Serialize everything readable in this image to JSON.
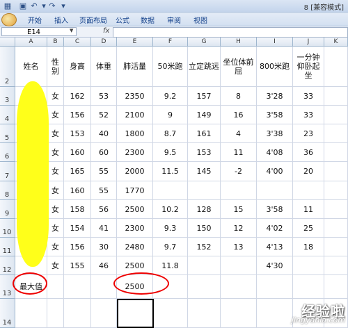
{
  "window": {
    "title": "8 [兼容模式]"
  },
  "ribbon": {
    "tabs": [
      "开始",
      "插入",
      "页面布局",
      "公式",
      "数据",
      "审阅",
      "视图"
    ]
  },
  "formula_bar": {
    "name_box": "E14",
    "fx_label": "fx",
    "formula": ""
  },
  "sheet": {
    "column_headers": [
      "A",
      "B",
      "C",
      "D",
      "E",
      "F",
      "G",
      "H",
      "I",
      "J",
      "K"
    ],
    "row_numbers": [
      "2",
      "3",
      "4",
      "5",
      "6",
      "7",
      "8",
      "9",
      "10",
      "11",
      "12",
      "13",
      "14"
    ],
    "header_row": [
      "姓名",
      "性别",
      "身高",
      "体重",
      "肺活量",
      "50米跑",
      "立定跳远",
      "坐位体前屈",
      "800米跑",
      "一分钟仰卧起坐"
    ],
    "rows": [
      [
        "",
        "女",
        "162",
        "53",
        "2350",
        "9.2",
        "157",
        "8",
        "3'28",
        "33"
      ],
      [
        "",
        "女",
        "156",
        "52",
        "2100",
        "9",
        "149",
        "16",
        "3'58",
        "33"
      ],
      [
        "",
        "女",
        "153",
        "40",
        "1800",
        "8.7",
        "161",
        "4",
        "3'38",
        "23"
      ],
      [
        "",
        "女",
        "160",
        "60",
        "2300",
        "9.5",
        "153",
        "11",
        "4'08",
        "36"
      ],
      [
        "",
        "女",
        "165",
        "55",
        "2000",
        "11.5",
        "145",
        "-2",
        "4'00",
        "20"
      ],
      [
        "",
        "女",
        "160",
        "55",
        "1770",
        "",
        "",
        "",
        "",
        ""
      ],
      [
        "",
        "女",
        "158",
        "56",
        "2500",
        "10.2",
        "128",
        "15",
        "3'58",
        "11"
      ],
      [
        "",
        "女",
        "154",
        "41",
        "2300",
        "9.3",
        "150",
        "12",
        "4'02",
        "25"
      ],
      [
        "",
        "女",
        "156",
        "30",
        "2480",
        "9.7",
        "152",
        "13",
        "4'13",
        "18"
      ],
      [
        "",
        "女",
        "155",
        "46",
        "2500",
        "11.8",
        "",
        "",
        "4'30",
        ""
      ]
    ],
    "summary_row": [
      "最大值",
      "",
      "",
      "",
      "2500",
      "",
      "",
      "",
      "",
      ""
    ],
    "selected_cell": "E14"
  },
  "watermark": {
    "main": "经验啦",
    "sub": "jingyanla.com",
    "check": "✓"
  }
}
